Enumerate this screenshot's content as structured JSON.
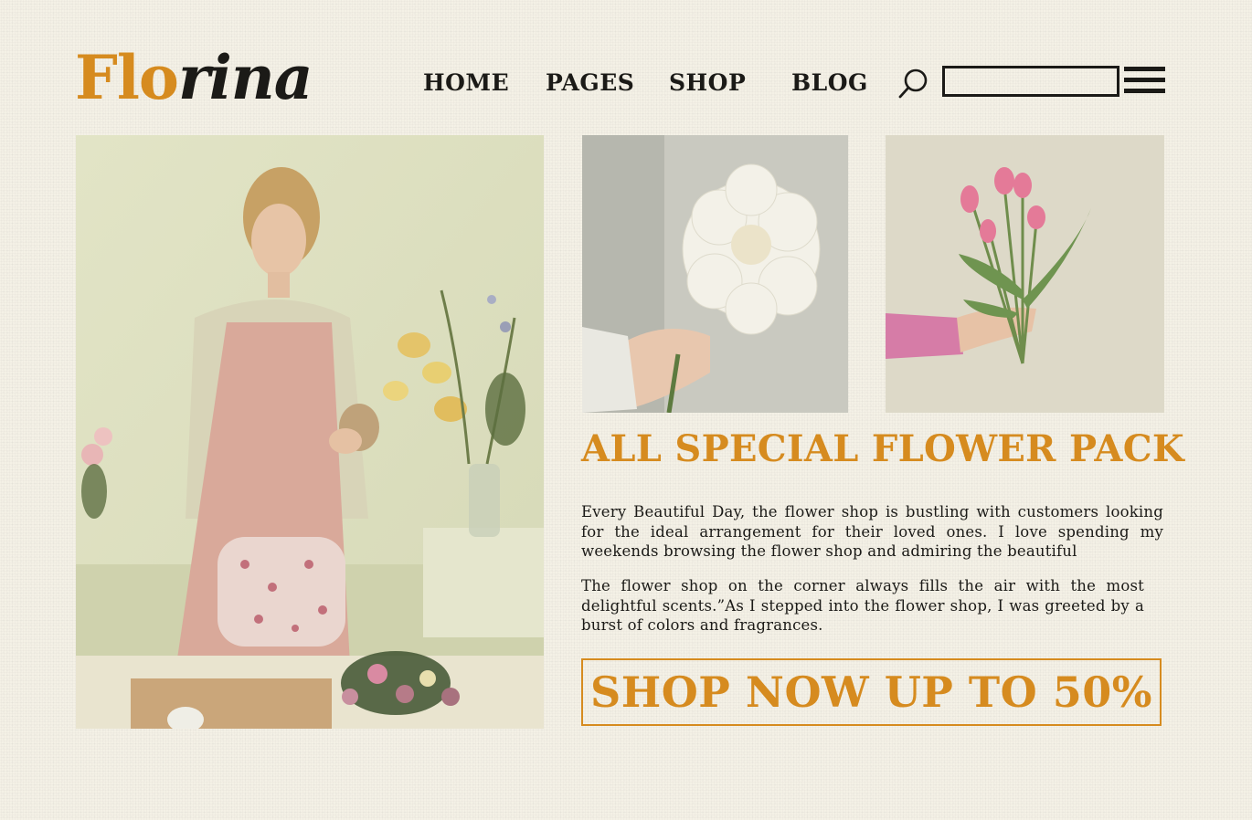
{
  "brand": {
    "logo_part1": "Flo",
    "logo_part2": "rina"
  },
  "nav": {
    "items": [
      "HOME",
      "PAGES",
      "SHOP",
      "BLOG"
    ]
  },
  "search": {
    "placeholder": ""
  },
  "icons": {
    "search": "search-icon",
    "menu": "hamburger-menu-icon"
  },
  "colors": {
    "accent": "#d68b1f",
    "text": "#1b1a17",
    "background": "#f4f1e6"
  },
  "hero": {
    "headline": "ALL SPECIAL FLOWER PACK",
    "paragraph1": "Every Beautiful Day, the flower shop is bustling with customers looking for the ideal arrangement for their loved ones. I love spending my weekends browsing the flower shop and admiring the beautiful",
    "paragraph2": "The flower shop on the corner always fills the air with the most delightful scents.”As I stepped into the flower shop, I was greeted by a burst of colors and fragrances.",
    "cta_label": "SHOP NOW UP TO 50%"
  }
}
